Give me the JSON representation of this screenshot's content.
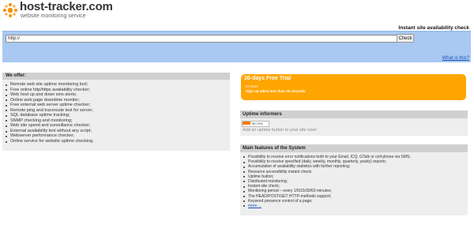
{
  "header": {
    "logo_icon": "host-tracker-logo-icon",
    "title": "host-tracker.com",
    "tagline": "website monitoring service"
  },
  "check": {
    "heading": "Instant site availability check",
    "url_value": "http://",
    "button_label": "Check",
    "what_link": "What is this?"
  },
  "offer": {
    "title": "We offer:",
    "items": [
      "Remote web site uptime monitoring tool;",
      "Free online http/https availability checker;",
      "Web host up and down sms alerts;",
      "Online web page downtime monitor;",
      "Free external web server uptime checker;",
      "Remote ping and traceroute test for server;",
      "SQL database uptime tracking;",
      "SNMP checking and monitoring;",
      "Web site speed and surveillance checker;",
      "External availability test without any script;",
      "Webserver performance checker;",
      "Online service for website uptime checking."
    ]
  },
  "trial": {
    "title": "30-days Free Trial",
    "line1": "It's free!",
    "line2": "Sign up takes less than 30 seconds"
  },
  "informers": {
    "title": "Uptime informers",
    "badge_text": "99.79%",
    "text": "Add an uptime button to your site now!"
  },
  "features": {
    "title": "Main features of the System",
    "items": [
      "Possibility to receive error notifications both to your Email, ICQ, GTalk or cell-phone via SMS;",
      "Possibility to receive specified (daily, weekly, monthly, quarterly, yearly) reports;",
      "Accumulation of availability statistics with further reporting;",
      "Resource accessibility instant check.",
      "Uptime button;",
      "Distributed monitoring;",
      "Instant site check;",
      "Monitoring period – every 1/5/15/30/60 minutes;",
      "The HEAD/POST/GET HTTP-methods support;",
      "Keyword presence control of a page;"
    ],
    "more_link": "more ..."
  },
  "colors": {
    "check_bar": "#a9c9f2",
    "trial_box": "#ffa500",
    "panel_header": "#d0d0d0",
    "panel_body": "#eeeeee",
    "link": "#1a4fb8",
    "logo_orange": "#f39200"
  }
}
